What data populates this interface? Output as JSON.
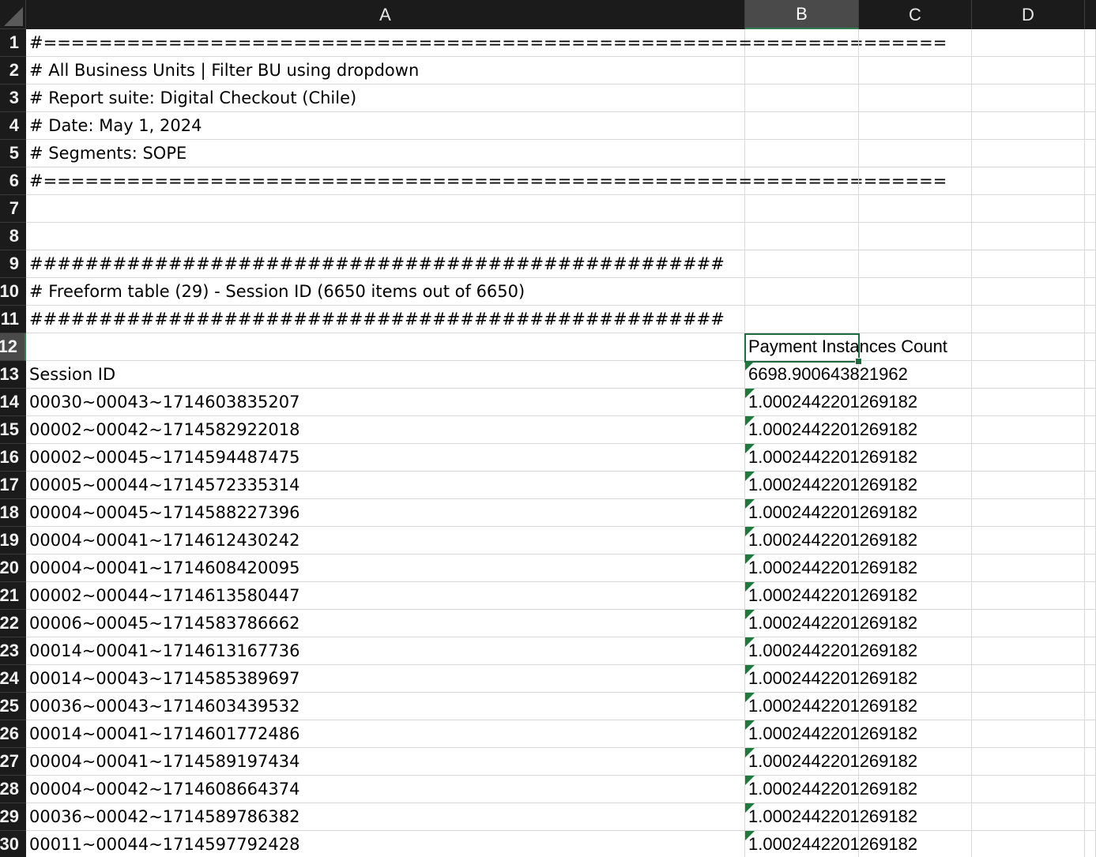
{
  "columns": [
    {
      "label": "A"
    },
    {
      "label": "B"
    },
    {
      "label": "C"
    },
    {
      "label": "D"
    }
  ],
  "active_cell": {
    "column": "B",
    "row": "12"
  },
  "accent_color": "#1e7a3c",
  "rows": [
    {
      "num": "1",
      "a": "#=================================================================",
      "b": ""
    },
    {
      "num": "2",
      "a": "# All  Business Units | Filter BU using dropdown",
      "b": ""
    },
    {
      "num": "3",
      "a": "# Report suite: Digital Checkout (Chile)",
      "b": ""
    },
    {
      "num": "4",
      "a": "# Date: May 1, 2024",
      "b": ""
    },
    {
      "num": "5",
      "a": "# Segments: SOPE",
      "b": ""
    },
    {
      "num": "6",
      "a": "#=================================================================",
      "b": ""
    },
    {
      "num": "7",
      "a": "",
      "b": ""
    },
    {
      "num": "8",
      "a": "",
      "b": ""
    },
    {
      "num": "9",
      "a": "##################################################",
      "b": ""
    },
    {
      "num": "10",
      "a": "# Freeform table (29) - Session ID (6650 items out of 6650)",
      "b": ""
    },
    {
      "num": "11",
      "a": "##################################################",
      "b": ""
    },
    {
      "num": "12",
      "a": "",
      "b": "Payment Instances Count"
    },
    {
      "num": "13",
      "a": "Session ID",
      "b": "6698.900643821962",
      "flag": true
    },
    {
      "num": "14",
      "a": "00030~00043~1714603835207",
      "b": "1.0002442201269182",
      "flag": true
    },
    {
      "num": "15",
      "a": "00002~00042~1714582922018",
      "b": "1.0002442201269182",
      "flag": true
    },
    {
      "num": "16",
      "a": "00002~00045~1714594487475",
      "b": "1.0002442201269182",
      "flag": true
    },
    {
      "num": "17",
      "a": "00005~00044~1714572335314",
      "b": "1.0002442201269182",
      "flag": true
    },
    {
      "num": "18",
      "a": "00004~00045~1714588227396",
      "b": "1.0002442201269182",
      "flag": true
    },
    {
      "num": "19",
      "a": "00004~00041~1714612430242",
      "b": "1.0002442201269182",
      "flag": true
    },
    {
      "num": "20",
      "a": "00004~00041~1714608420095",
      "b": "1.0002442201269182",
      "flag": true
    },
    {
      "num": "21",
      "a": "00002~00044~1714613580447",
      "b": "1.0002442201269182",
      "flag": true
    },
    {
      "num": "22",
      "a": "00006~00045~1714583786662",
      "b": "1.0002442201269182",
      "flag": true
    },
    {
      "num": "23",
      "a": "00014~00041~1714613167736",
      "b": "1.0002442201269182",
      "flag": true
    },
    {
      "num": "24",
      "a": "00014~00043~1714585389697",
      "b": "1.0002442201269182",
      "flag": true
    },
    {
      "num": "25",
      "a": "00036~00043~1714603439532",
      "b": "1.0002442201269182",
      "flag": true
    },
    {
      "num": "26",
      "a": "00014~00041~1714601772486",
      "b": "1.0002442201269182",
      "flag": true
    },
    {
      "num": "27",
      "a": "00004~00041~1714589197434",
      "b": "1.0002442201269182",
      "flag": true
    },
    {
      "num": "28",
      "a": "00004~00042~1714608664374",
      "b": "1.0002442201269182",
      "flag": true
    },
    {
      "num": "29",
      "a": "00036~00042~1714589786382",
      "b": "1.0002442201269182",
      "flag": true
    },
    {
      "num": "30",
      "a": "00011~00044~1714597792428",
      "b": "1.0002442201269182",
      "flag": true
    }
  ]
}
